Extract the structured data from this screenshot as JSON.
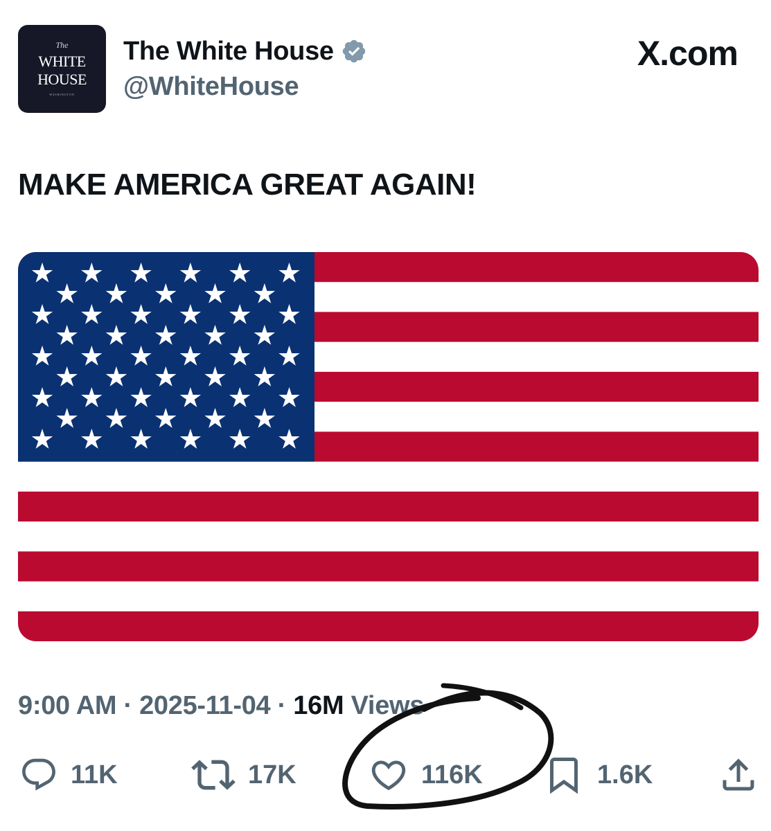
{
  "account": {
    "display_name": "The White House",
    "handle": "@WhiteHouse",
    "verified": true,
    "avatar": {
      "line_top": "The",
      "line_1": "WHITE",
      "line_2": "HOUSE",
      "line_bottom": "WASHINGTON"
    }
  },
  "source_label": "X.com",
  "tweet": {
    "text": "MAKE AMERICA GREAT AGAIN!",
    "media": {
      "icon": "us-flag",
      "colors": {
        "red": "#bb0a30",
        "white": "#ffffff",
        "blue": "#0a3172"
      }
    },
    "time": "9:00 AM",
    "date": "2025-11-04",
    "views_count": "16M",
    "views_label": "Views",
    "separator": "·"
  },
  "actions": {
    "replies": {
      "count": "11K",
      "icon": "reply-icon"
    },
    "reposts": {
      "count": "17K",
      "icon": "repost-icon"
    },
    "likes": {
      "count": "116K",
      "icon": "heart-icon"
    },
    "bookmarks": {
      "count": "1.6K",
      "icon": "bookmark-icon"
    },
    "share": {
      "icon": "share-icon"
    }
  },
  "colors": {
    "text_primary": "#0f1419",
    "text_secondary": "#536471",
    "verified_badge": "#829aab",
    "avatar_bg": "#161827",
    "annotation_ink": "#111111"
  }
}
